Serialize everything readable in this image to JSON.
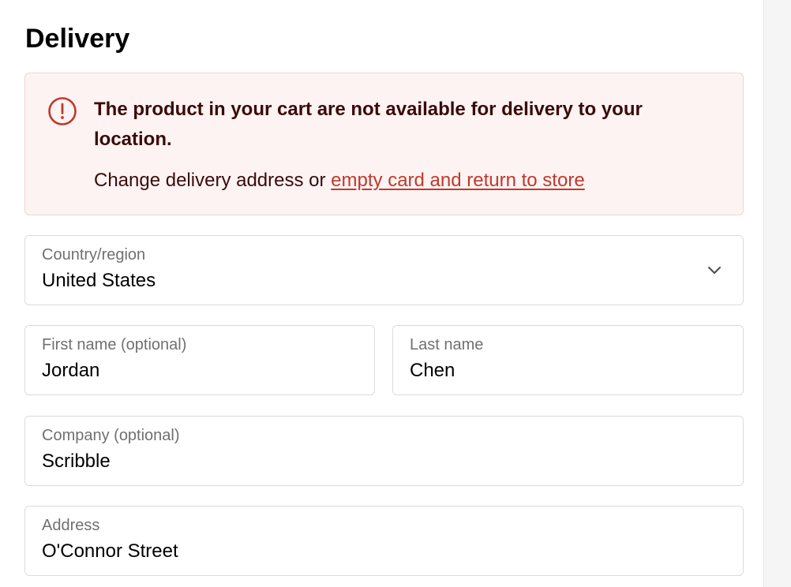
{
  "page": {
    "title": "Delivery"
  },
  "alert": {
    "icon": "alert-circle-icon",
    "title": "The product in your cart are not available for delivery to your location.",
    "body_prefix": "Change delivery address or ",
    "link_label": "empty card and return to store",
    "colors": {
      "background": "#fdf3f3",
      "border": "#f2d3d3",
      "text": "#3b0a0a",
      "accent": "#c0392b"
    }
  },
  "form": {
    "country": {
      "label": "Country/region",
      "value": "United States",
      "icon": "chevron-down-icon"
    },
    "first_name": {
      "label": "First name (optional)",
      "value": "Jordan"
    },
    "last_name": {
      "label": "Last name",
      "value": "Chen"
    },
    "company": {
      "label": "Company (optional)",
      "value": "Scribble"
    },
    "address": {
      "label": "Address",
      "value": "O'Connor Street"
    }
  }
}
